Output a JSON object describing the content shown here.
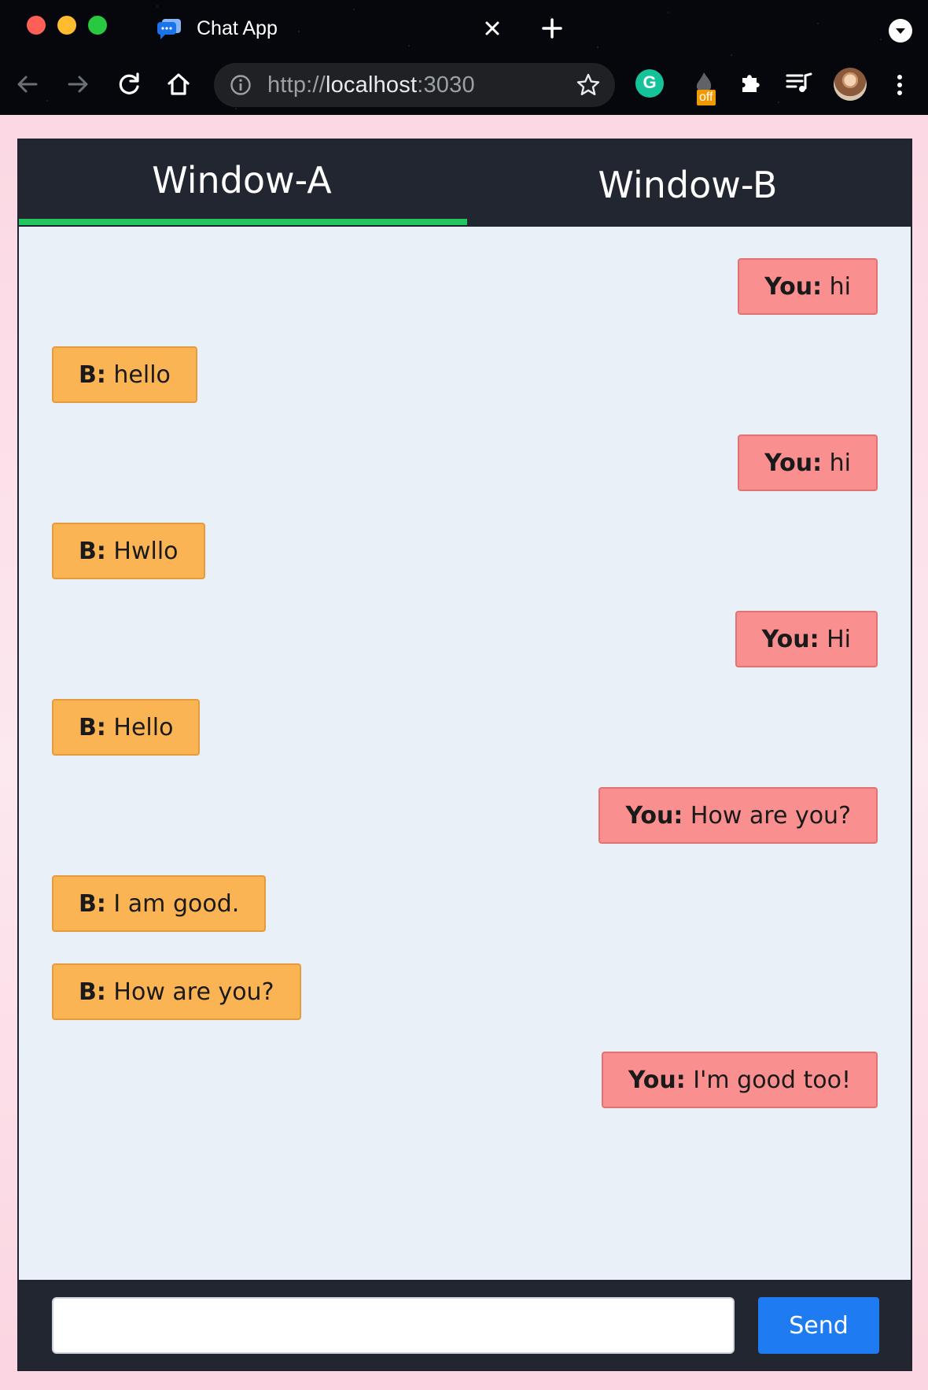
{
  "browser": {
    "tab_title": "Chat App",
    "url_scheme": "http://",
    "url_host": "localhost",
    "url_port": ":3030",
    "extension_badge": "off",
    "icons": [
      "back-arrow-icon",
      "forward-arrow-icon",
      "reload-icon",
      "home-icon",
      "info-icon",
      "star-icon",
      "grammarly-icon",
      "fire-extension-icon",
      "puzzle-icon",
      "media-queue-icon",
      "profile-avatar",
      "kebab-menu-icon"
    ]
  },
  "app": {
    "tabs": [
      {
        "label": "Window-A",
        "active": true
      },
      {
        "label": "Window-B",
        "active": false
      }
    ],
    "accent_color": "#22c55e",
    "messages": [
      {
        "sender": "You:",
        "text": " hi",
        "side": "right"
      },
      {
        "sender": "B:",
        "text": " hello",
        "side": "left"
      },
      {
        "sender": "You:",
        "text": " hi",
        "side": "right"
      },
      {
        "sender": "B:",
        "text": " Hwllo",
        "side": "left"
      },
      {
        "sender": "You:",
        "text": " Hi",
        "side": "right"
      },
      {
        "sender": "B:",
        "text": " Hello",
        "side": "left"
      },
      {
        "sender": "You:",
        "text": " How are you?",
        "side": "right"
      },
      {
        "sender": "B:",
        "text": " I am good.",
        "side": "left"
      },
      {
        "sender": "B:",
        "text": " How are you?",
        "side": "left"
      },
      {
        "sender": "You:",
        "text": " I'm good too!",
        "side": "right"
      }
    ],
    "composer": {
      "input_value": "",
      "send_label": "Send"
    }
  }
}
